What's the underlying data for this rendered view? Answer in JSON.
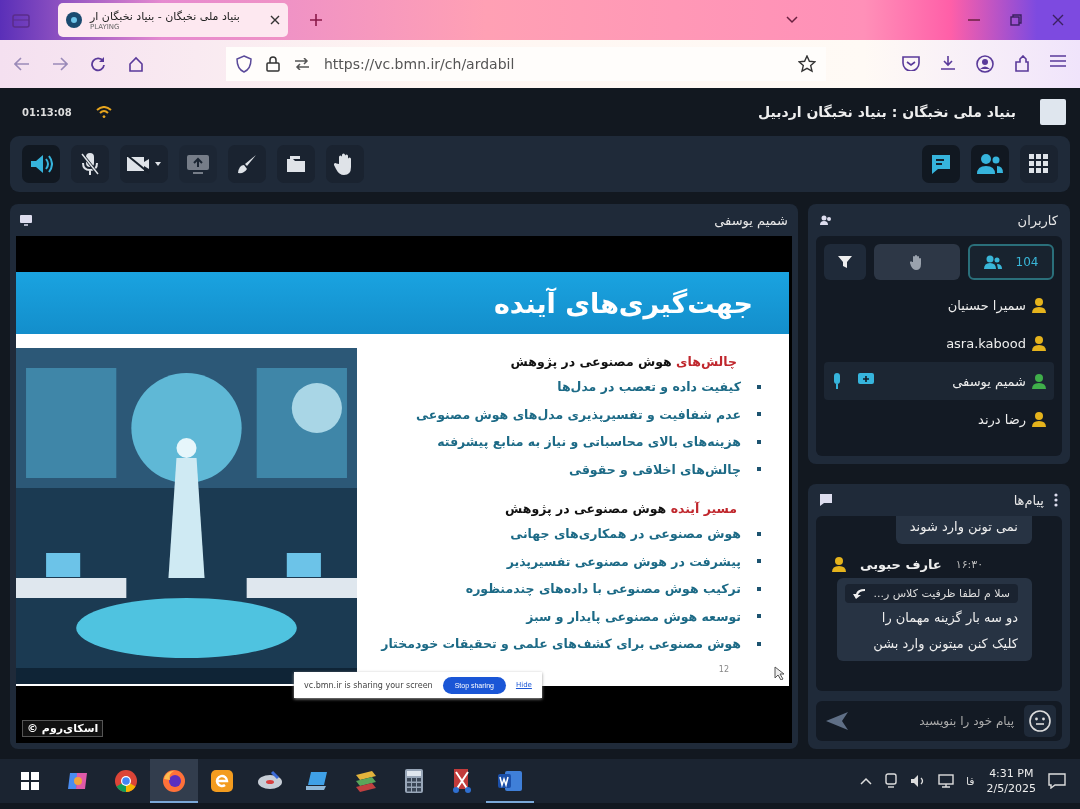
{
  "browser": {
    "tab": {
      "title": "بنیاد ملی نخبگان - بنیاد نخبگان ار",
      "status": "PLAYING"
    },
    "url": "https://vc.bmn.ir/ch/ardabil"
  },
  "header": {
    "time": "01:13:08",
    "title": "بنیاد ملی نخبگان : بنیاد نخبگان اردبیل"
  },
  "toolbar": {
    "left": [
      {
        "on": true,
        "disabled": false
      },
      {
        "on": false,
        "disabled": false
      },
      {
        "on": false,
        "disabled": false
      },
      {
        "on": false,
        "disabled": true
      },
      {
        "on": false,
        "disabled": false
      },
      {
        "on": false,
        "disabled": false
      },
      {
        "on": false,
        "disabled": false
      }
    ],
    "right": [
      {
        "on": true
      },
      {
        "on": true
      },
      {
        "on": false
      }
    ]
  },
  "video": {
    "presenter": "شمیم یوسفی",
    "slide": {
      "title": "جهت‌گیری‌های آینده",
      "page": "12",
      "sections": [
        {
          "accent": "چالش‌های",
          "heading": "هوش مصنوعی در پژوهش",
          "bullets": [
            "کیفیت داده و تعصب در مدل‌ها",
            "عدم شفافیت و تفسیرپذیری مدل‌های هوش مصنوعی",
            "هزینه‌های بالای محاسباتی و نیاز به منابع پیشرفته",
            "چالش‌های اخلاقی و حقوقی"
          ]
        },
        {
          "accent": "مسیر آینده",
          "heading": "هوش مصنوعی در پژوهش",
          "bullets": [
            "هوش مصنوعی در همکاری‌های جهانی",
            "پیشرفت در هوش مصنوعی تفسیرپذیر",
            "ترکیب هوش مصنوعی با داده‌های چندمنظوره",
            "توسعه هوش مصنوعی پایدار و سبز",
            "هوش مصنوعی برای کشف‌های علمی و تحقیقات خودمختار"
          ]
        }
      ]
    },
    "share_bar": {
      "text": "vc.bmn.ir is sharing your screen",
      "stop": "Stop sharing",
      "hide": "Hide"
    },
    "brand": "اسکای‌روم ©"
  },
  "users": {
    "title": "کاربران",
    "count": "104",
    "items": [
      {
        "name": "سمیرا حسنیان",
        "color": "#e5b31c",
        "selected": false,
        "presenter": false
      },
      {
        "name": "asra.kabood",
        "color": "#e5b31c",
        "selected": false,
        "presenter": false
      },
      {
        "name": "شمیم یوسفی",
        "color": "#3fae4a",
        "selected": true,
        "presenter": true
      },
      {
        "name": "رضا درند",
        "color": "#e5b31c",
        "selected": false,
        "presenter": false
      }
    ]
  },
  "messages": {
    "title": "پیام‌ها",
    "items": [
      {
        "kind": "bubble",
        "lines": [
          "نمی تونن وارد شوند"
        ]
      },
      {
        "kind": "sender",
        "name": "عارف حبوبی",
        "time": "۱۶:۳۰"
      },
      {
        "kind": "reply",
        "quote": "سلا م لطفا ظرفیت کلاس ر...",
        "lines": [
          "دو سه بار گزینه مهمان را",
          "کلیک کنن میتونن وارد بشن"
        ]
      }
    ],
    "placeholder": "پیام خود را بنویسید"
  },
  "taskbar": {
    "apps": [
      {
        "selected": false,
        "running": false
      },
      {
        "selected": false,
        "running": false
      },
      {
        "selected": true,
        "running": true
      },
      {
        "selected": false,
        "running": false
      },
      {
        "selected": false,
        "running": false
      },
      {
        "selected": false,
        "running": false
      },
      {
        "selected": false,
        "running": false
      },
      {
        "selected": false,
        "running": false
      },
      {
        "selected": false,
        "running": false
      },
      {
        "selected": false,
        "running": true
      }
    ],
    "language": "فا",
    "time": "4:31 PM",
    "date": "2/5/2025"
  }
}
